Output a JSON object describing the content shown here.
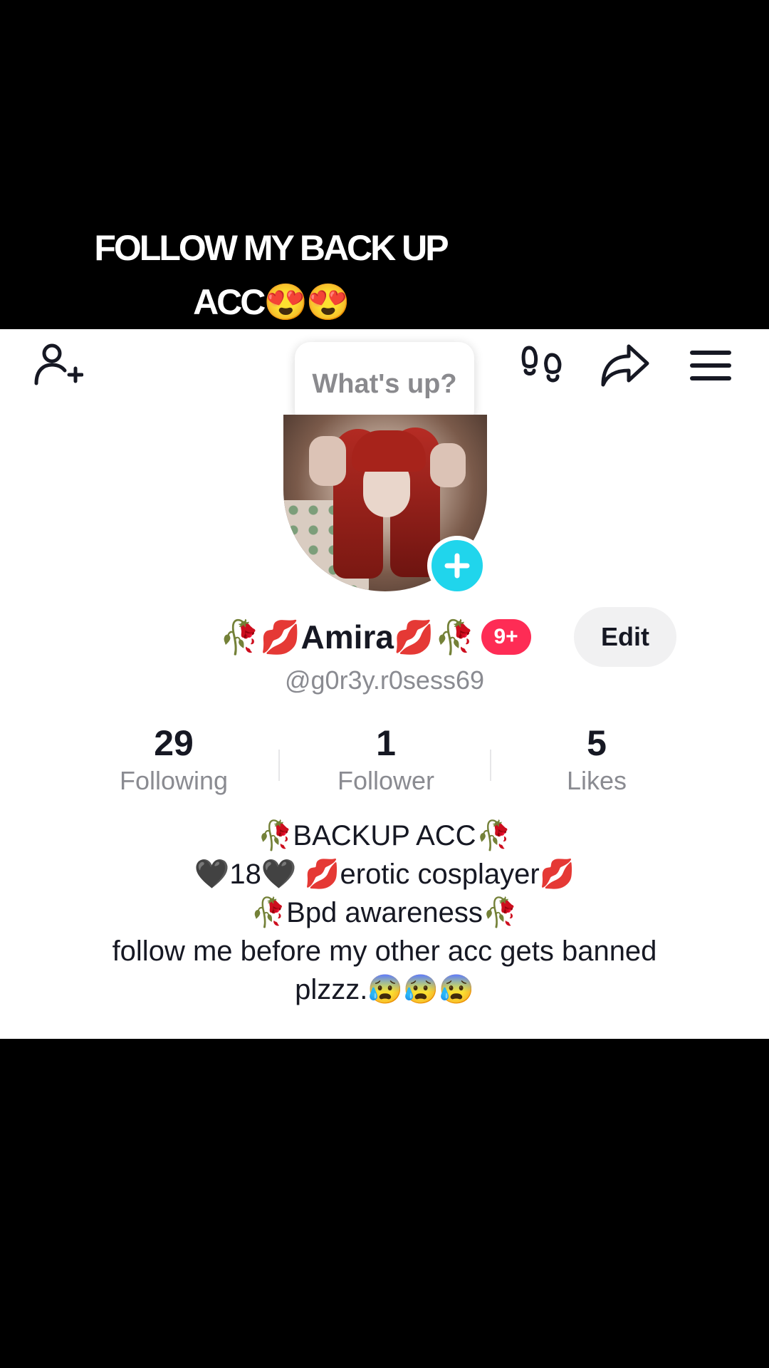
{
  "caption": {
    "line1": "FOLLOW MY BACK UP",
    "line2": "ACC😍😍"
  },
  "header": {
    "bubble_text": "What's up?",
    "icons": [
      "add-friend-icon",
      "footprint-icon",
      "share-icon",
      "menu-icon"
    ]
  },
  "profile": {
    "display_name": "🥀💋Amira💋🥀",
    "notification_badge": "9+",
    "edit_label": "Edit",
    "handle": "@g0r3y.r0sess69"
  },
  "stats": {
    "following_count": "29",
    "following_label": "Following",
    "followers_count": "1",
    "followers_label": "Follower",
    "likes_count": "5",
    "likes_label": "Likes"
  },
  "bio": {
    "lines": [
      "🥀BACKUP ACC🥀",
      "🖤18🖤 💋erotic cosplayer💋",
      "🥀Bpd awareness🥀",
      "follow me before my other acc gets banned",
      "plzzz.😰😰😰"
    ]
  },
  "colors": {
    "accent_red": "#fe2c55",
    "plus_badge": "#20d5ec",
    "text_primary": "#161823",
    "text_secondary": "#8a8b91"
  }
}
